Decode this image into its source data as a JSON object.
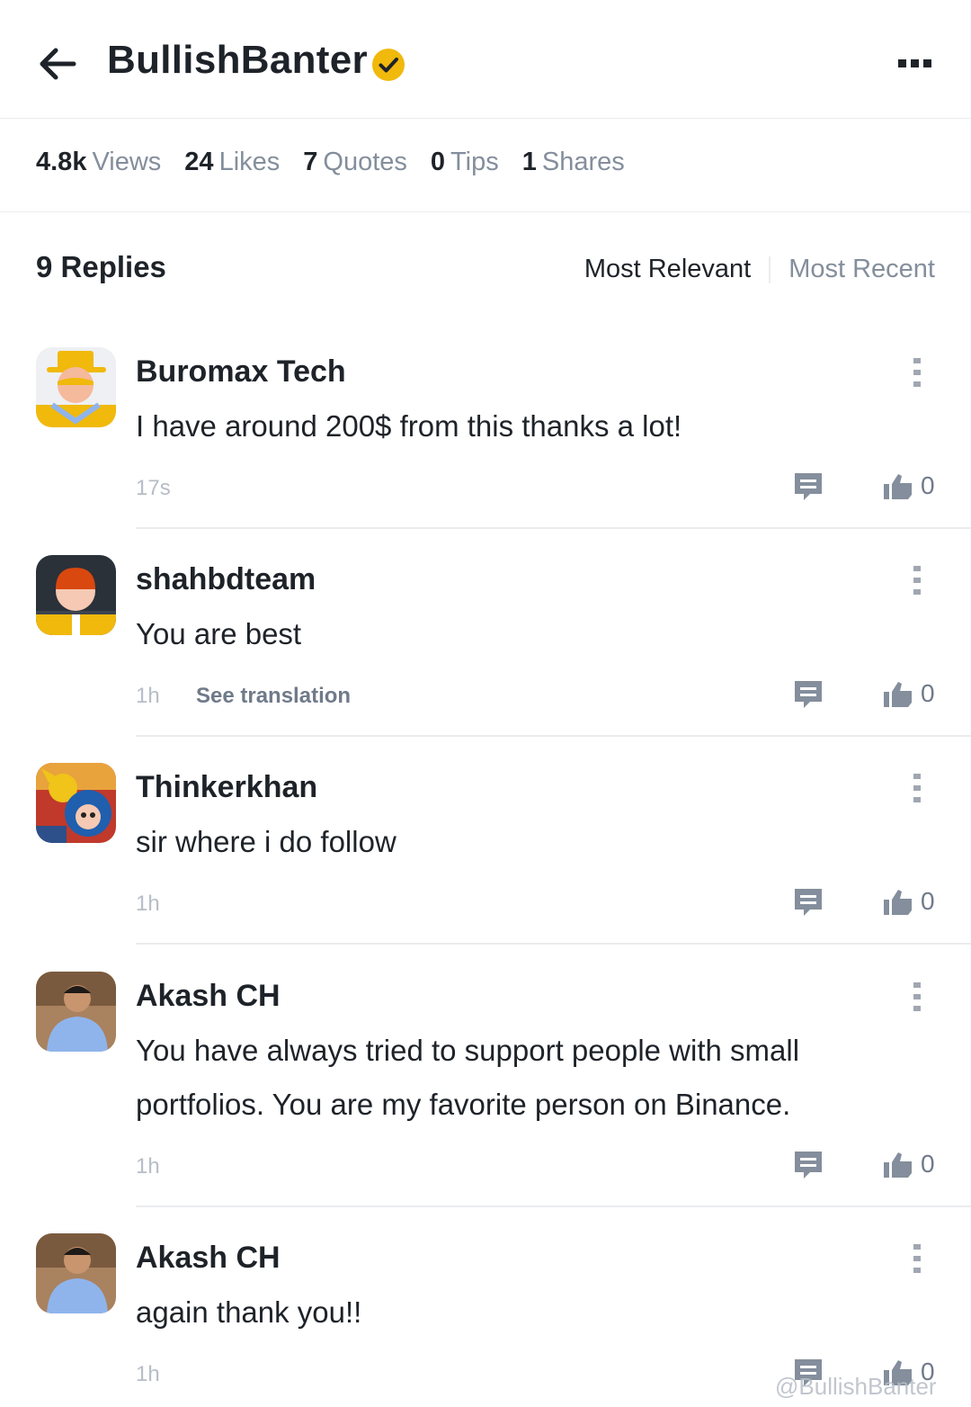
{
  "header": {
    "title": "BullishBanter",
    "verified_color": "#f0b90b",
    "icons": [
      "arrow-left-icon",
      "verified-badge-icon",
      "more-horizontal-icon"
    ]
  },
  "stats": [
    {
      "value": "4.8k",
      "label": "Views"
    },
    {
      "value": "24",
      "label": "Likes"
    },
    {
      "value": "7",
      "label": "Quotes"
    },
    {
      "value": "0",
      "label": "Tips"
    },
    {
      "value": "1",
      "label": "Shares"
    }
  ],
  "replies_section": {
    "title": "9 Replies",
    "sort_relevant": "Most Relevant",
    "sort_recent": "Most Recent",
    "selected_sort": "Most Relevant"
  },
  "replies": [
    {
      "user": "Buromax Tech",
      "text": "I have around 200$ from this thanks a lot!",
      "time": "17s",
      "likes": "0"
    },
    {
      "user": "shahbdteam",
      "text": "You are best",
      "time": "1h",
      "translate": "See translation",
      "likes": "0"
    },
    {
      "user": "Thinkerkhan",
      "text": "sir where i do follow",
      "time": "1h",
      "likes": "0"
    },
    {
      "user": "Akash CH",
      "text": "You have always tried to support people with small portfolios. You are my favorite person on Binance.",
      "time": "1h",
      "likes": "0"
    },
    {
      "user": "Akash CH",
      "text": "again thank you!!",
      "time": "1h",
      "likes": "0"
    }
  ],
  "watermark": "@BullishBanter",
  "colors": {
    "accent": "#f0b90b",
    "text_primary": "#1e2329",
    "text_secondary": "#848e9c",
    "divider": "#eaecef"
  }
}
